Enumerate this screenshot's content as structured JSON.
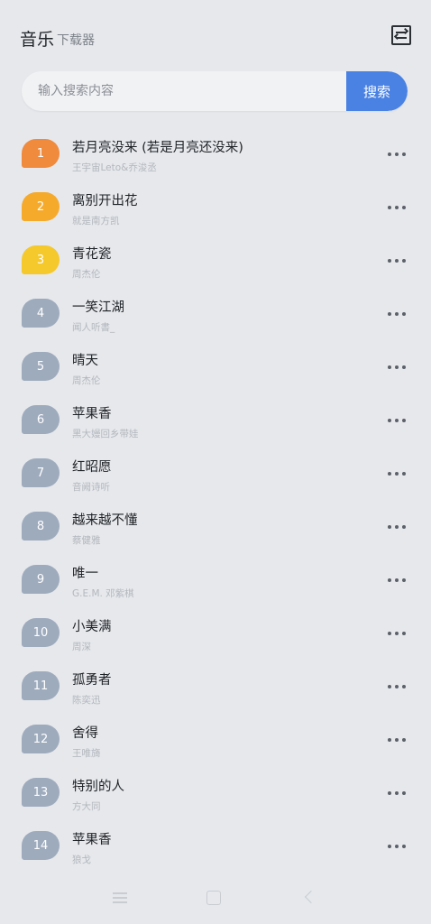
{
  "header": {
    "title": "音乐",
    "subtitle": "下载器",
    "switch_icon": "swap-icon"
  },
  "search": {
    "placeholder": "输入搜索内容",
    "button_label": "搜索"
  },
  "colors": {
    "accent": "#4a82e4",
    "badge_1": "#f08a3c",
    "badge_2": "#f6aa2c",
    "badge_3": "#f5c92c",
    "badge_default": "#9eabbd"
  },
  "songs": [
    {
      "rank": "1",
      "title": "若月亮没来 (若是月亮还没来)",
      "artist": "王宇宙Leto&乔浚丞"
    },
    {
      "rank": "2",
      "title": "离别开出花",
      "artist": "就是南方凯"
    },
    {
      "rank": "3",
      "title": "青花瓷",
      "artist": "周杰伦"
    },
    {
      "rank": "4",
      "title": "一笑江湖",
      "artist": "闻人听書_"
    },
    {
      "rank": "5",
      "title": "晴天",
      "artist": "周杰伦"
    },
    {
      "rank": "6",
      "title": "苹果香",
      "artist": "黑大嫚回乡带娃"
    },
    {
      "rank": "7",
      "title": "红昭愿",
      "artist": "音阙诗听"
    },
    {
      "rank": "8",
      "title": "越来越不懂",
      "artist": "蔡健雅"
    },
    {
      "rank": "9",
      "title": "唯一",
      "artist": "G.E.M. 邓紫棋"
    },
    {
      "rank": "10",
      "title": "小美满",
      "artist": "周深"
    },
    {
      "rank": "11",
      "title": "孤勇者",
      "artist": "陈奕迅"
    },
    {
      "rank": "12",
      "title": "舍得",
      "artist": "王唯旖"
    },
    {
      "rank": "13",
      "title": "特别的人",
      "artist": "方大同"
    },
    {
      "rank": "14",
      "title": "苹果香",
      "artist": "狼戈"
    }
  ],
  "navbar": {
    "menu_icon": "menu-icon",
    "home_icon": "home-icon",
    "back_icon": "back-icon"
  }
}
